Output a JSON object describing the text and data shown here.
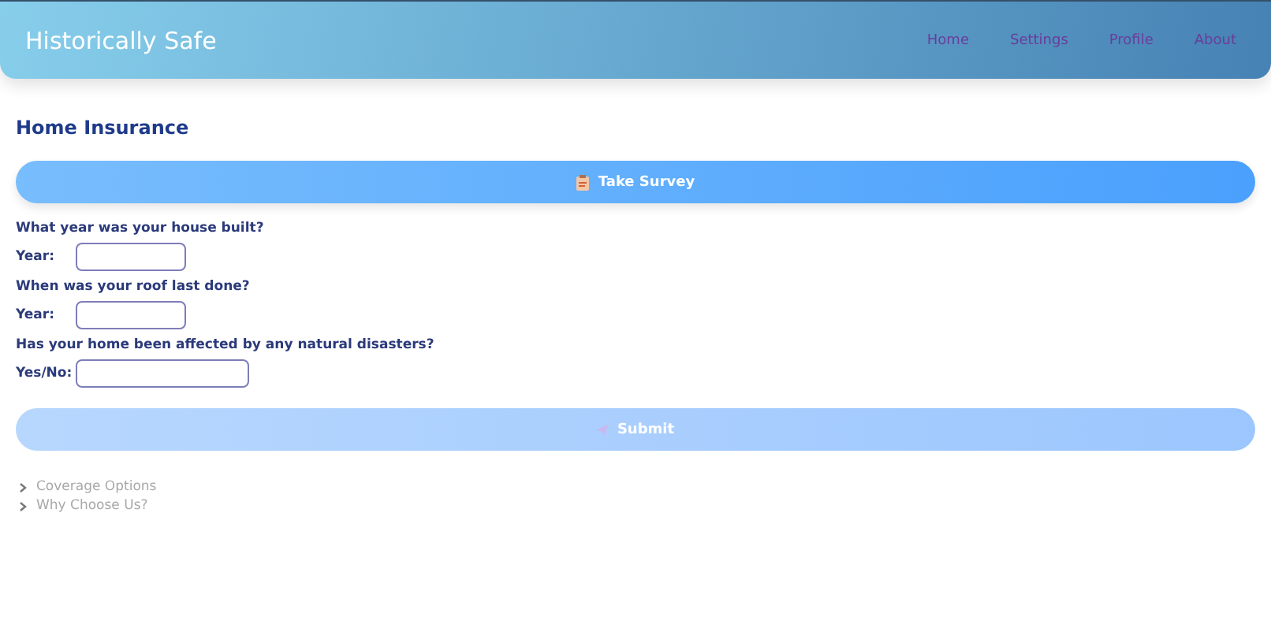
{
  "header": {
    "title": "Historically Safe",
    "nav": [
      {
        "label": "Home"
      },
      {
        "label": "Settings"
      },
      {
        "label": "Profile"
      },
      {
        "label": "About"
      }
    ]
  },
  "heading": "Home Insurance",
  "survey_button": {
    "label": "Take Survey"
  },
  "questions": [
    {
      "question": "What year was your house built?",
      "label": "Year:",
      "kind": "year"
    },
    {
      "question": "When was your roof last done?",
      "label": "Year:",
      "kind": "year"
    },
    {
      "question": "Has your home been affected by any natural disasters?",
      "label": "Yes/No:",
      "kind": "text"
    }
  ],
  "submit_button": {
    "label": "Submit",
    "disabled": true
  },
  "sections": [
    {
      "label": "Coverage Options",
      "expanded": false
    },
    {
      "label": "Why Choose Us?",
      "expanded": false
    }
  ]
}
